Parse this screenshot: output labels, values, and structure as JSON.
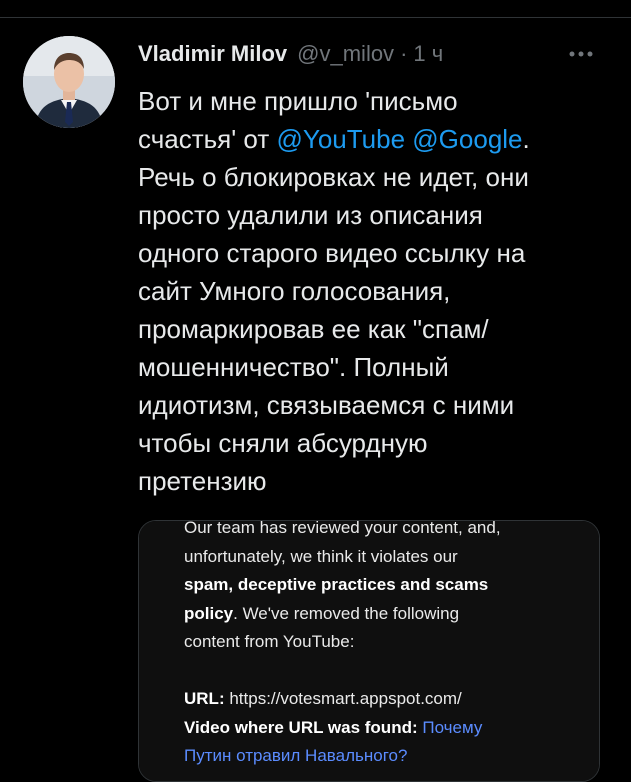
{
  "tweet": {
    "author_name": "Vladimir Milov",
    "handle": "@v_milov",
    "separator": "·",
    "time": "1 ч",
    "more_icon": "more-horizontal-icon",
    "text_lines": [
      {
        "pre": "Вот и мне пришло 'письмо"
      },
      {
        "pre": "счастья' от ",
        "m1": "@YouTube",
        "mid": " ",
        "m2": "@Google",
        "post": "."
      },
      {
        "pre": "Речь о блокировках не идет, они"
      },
      {
        "pre": "просто удалили из описания"
      },
      {
        "pre": "одного старого видео ссылку на"
      },
      {
        "pre": "сайт Умного голосования,"
      },
      {
        "pre": "промаркировав ее как \"спам/"
      },
      {
        "pre": "мошенничество\". Полный"
      },
      {
        "pre": "идиотизм, связываемся с ними"
      },
      {
        "pre": "чтобы сняли абсурдную"
      },
      {
        "pre": "претензию"
      }
    ]
  },
  "media": {
    "email_lines": {
      "l1": "Our team has reviewed your content, and,",
      "l2": "unfortunately, we think it violates our",
      "l3_bold": "spam, deceptive practices and scams",
      "l4_bold": "policy",
      "l4_rest": ". We've removed the following",
      "l5": "content from YouTube:",
      "url_label": "URL:",
      "url_value": " https://votesmart.appspot.com/",
      "video_label": "Video where URL was found:",
      "video_link": " Почему",
      "video_link_2": "Путин отравил Навального?"
    }
  },
  "colors": {
    "background": "#000000",
    "text": "#e7e9ea",
    "secondary": "#71767b",
    "accent": "#1d9bf0",
    "email_link": "#5b8cff"
  }
}
